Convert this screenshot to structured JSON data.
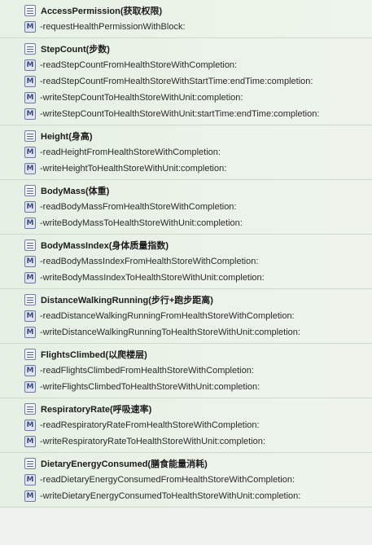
{
  "outline": {
    "sections": [
      {
        "title": "AccessPermission(获取权限)",
        "methods": [
          "-requestHealthPermissionWithBlock:"
        ]
      },
      {
        "title": "StepCount(步数)",
        "methods": [
          "-readStepCountFromHealthStoreWithCompletion:",
          "-readStepCountFromHealthStoreWithStartTime:endTime:completion:",
          "-writeStepCountToHealthStoreWithUnit:completion:",
          "-writeStepCountToHealthStoreWithUnit:startTime:endTime:completion:"
        ]
      },
      {
        "title": "Height(身高)",
        "methods": [
          "-readHeightFromHealthStoreWithCompletion:",
          "-writeHeightToHealthStoreWithUnit:completion:"
        ]
      },
      {
        "title": "BodyMass(体重)",
        "methods": [
          "-readBodyMassFromHealthStoreWithCompletion:",
          "-writeBodyMassToHealthStoreWithUnit:completion:"
        ]
      },
      {
        "title": "BodyMassIndex(身体质量指数)",
        "methods": [
          "-readBodyMassIndexFromHealthStoreWithCompletion:",
          "-writeBodyMassIndexToHealthStoreWithUnit:completion:"
        ]
      },
      {
        "title": "DistanceWalkingRunning(步行+跑步距离)",
        "methods": [
          "-readDistanceWalkingRunningFromHealthStoreWithCompletion:",
          "-writeDistanceWalkingRunningToHealthStoreWithUnit:completion:"
        ]
      },
      {
        "title": "FlightsClimbed(以爬楼层)",
        "methods": [
          "-readFlightsClimbedFromHealthStoreWithCompletion:",
          "-writeFlightsClimbedToHealthStoreWithUnit:completion:"
        ]
      },
      {
        "title": "RespiratoryRate(呼吸速率)",
        "methods": [
          "-readRespiratoryRateFromHealthStoreWithCompletion:",
          "-writeRespiratoryRateToHealthStoreWithUnit:completion:"
        ]
      },
      {
        "title": "DietaryEnergyConsumed(膳食能量消耗)",
        "methods": [
          "-readDietaryEnergyConsumedFromHealthStoreWithCompletion:",
          "-writeDietaryEnergyConsumedToHealthStoreWithUnit:completion:"
        ]
      }
    ],
    "method_badge": "M",
    "icons": {
      "mark": "list-icon",
      "method": "method-icon"
    }
  }
}
